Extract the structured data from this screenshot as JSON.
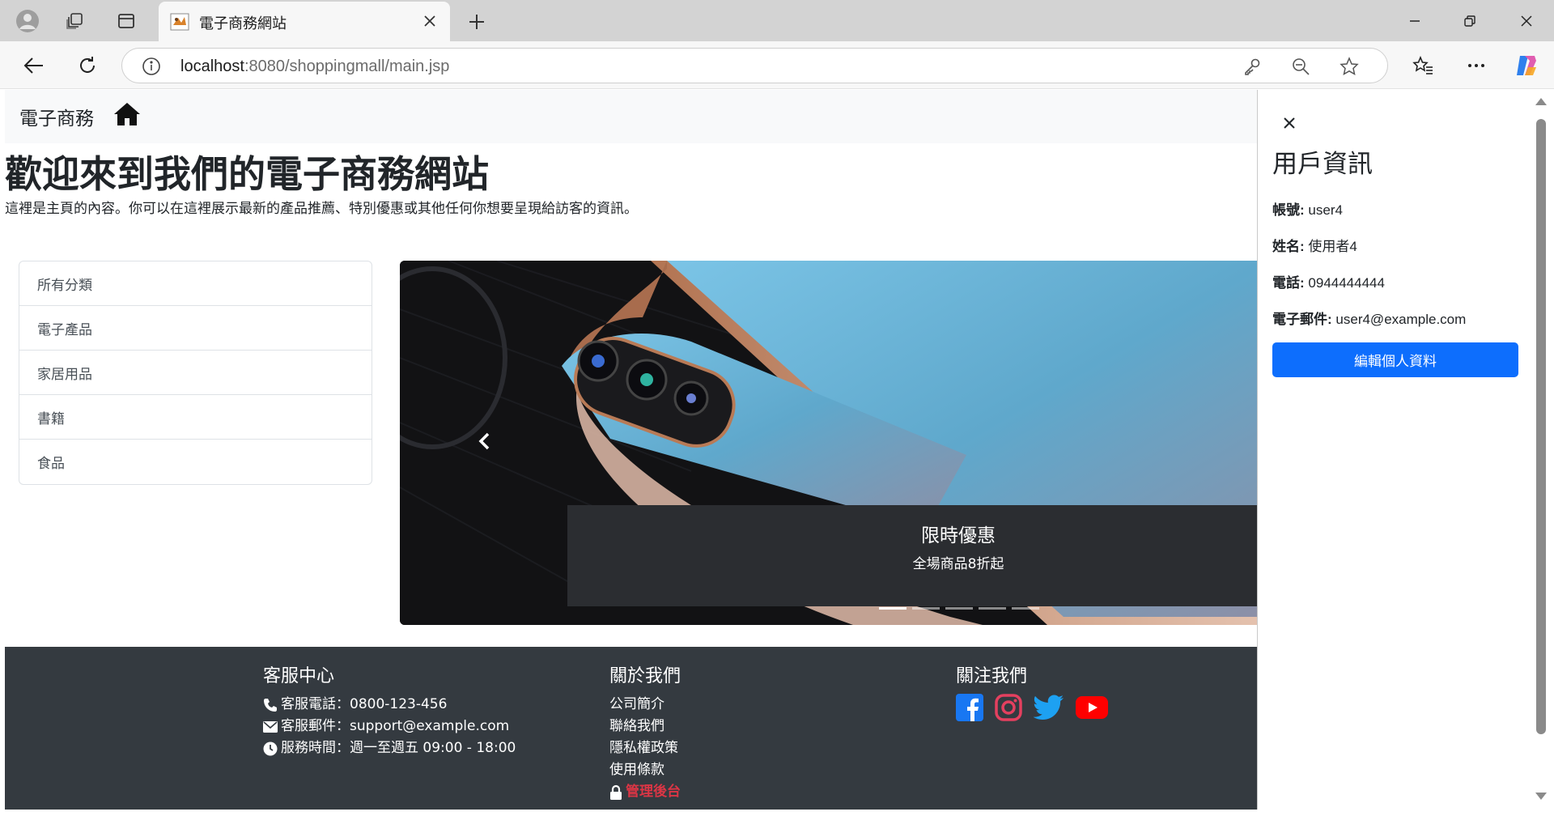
{
  "browser": {
    "tab_title": "電子商務網站",
    "url_host": "localhost",
    "url_rest": ":8080/shoppingmall/main.jsp"
  },
  "navbar": {
    "brand": "電子商務"
  },
  "hero": {
    "title": "歡迎來到我們的電子商務網站",
    "lead": "這裡是主頁的內容。你可以在這裡展示最新的產品推薦、特別優惠或其他任何你想要呈現給訪客的資訊。"
  },
  "categories": [
    "所有分類",
    "電子產品",
    "家居用品",
    "書籍",
    "食品"
  ],
  "carousel": {
    "caption_title": "限時優惠",
    "caption_text": "全場商品8折起",
    "slide_count": 5,
    "active_index": 0
  },
  "footer": {
    "service": {
      "heading": "客服中心",
      "phone": "客服電話：0800-123-456",
      "email": "客服郵件：support@example.com",
      "hours": "服務時間：週一至週五 09:00 - 18:00"
    },
    "about": {
      "heading": "關於我們",
      "links": [
        "公司簡介",
        "聯絡我們",
        "隱私權政策",
        "使用條款"
      ],
      "admin": "管理後台"
    },
    "follow": {
      "heading": "關注我們",
      "icons": [
        "facebook-icon",
        "instagram-icon",
        "twitter-icon",
        "youtube-icon"
      ]
    }
  },
  "offcanvas": {
    "title": "用戶資訊",
    "account_label": "帳號:",
    "account": "user4",
    "name_label": "姓名:",
    "name": "使用者4",
    "phone_label": "電話:",
    "phone": "0944444444",
    "email_label": "電子郵件:",
    "email": "user4@example.com",
    "edit_button": "編輯個人資料"
  },
  "colors": {
    "primary": "#0d6efd",
    "footer_bg": "#343a40",
    "admin_link": "#dc3545",
    "facebook": "#1877f2",
    "instagram": "#e4405f",
    "twitter": "#1da1f2",
    "youtube": "#ff0000"
  }
}
